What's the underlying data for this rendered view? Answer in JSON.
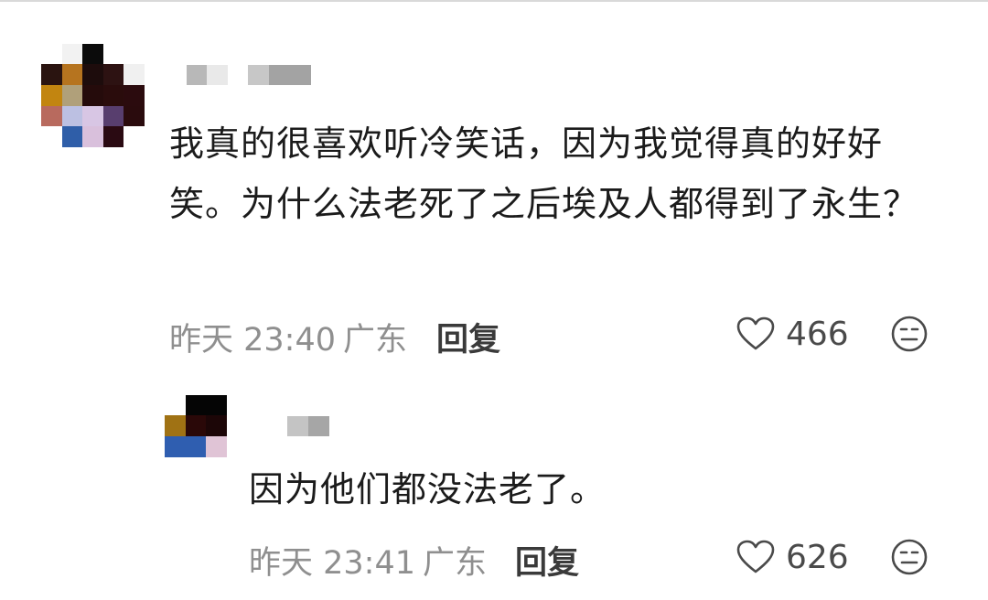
{
  "comments": [
    {
      "user_name": "",
      "text": "我真的很喜欢听冷笑话，因为我觉得真的好好笑。为什么法老死了之后埃及人都得到了永生？",
      "time": "昨天 23:40",
      "location": "广东",
      "reply_label": "回复",
      "likes": "466",
      "icons": {
        "like": "heart-outline-icon",
        "react": "neutral-face-icon"
      }
    },
    {
      "user_name": "",
      "text": "因为他们都没法老了。",
      "time": "昨天 23:41",
      "location": "广东",
      "reply_label": "回复",
      "likes": "626",
      "icons": {
        "like": "heart-outline-icon",
        "react": "neutral-face-icon"
      }
    }
  ],
  "colors": {
    "meta": "#8f8f8f",
    "text": "#1b1b1b",
    "background": "#ffffff"
  }
}
